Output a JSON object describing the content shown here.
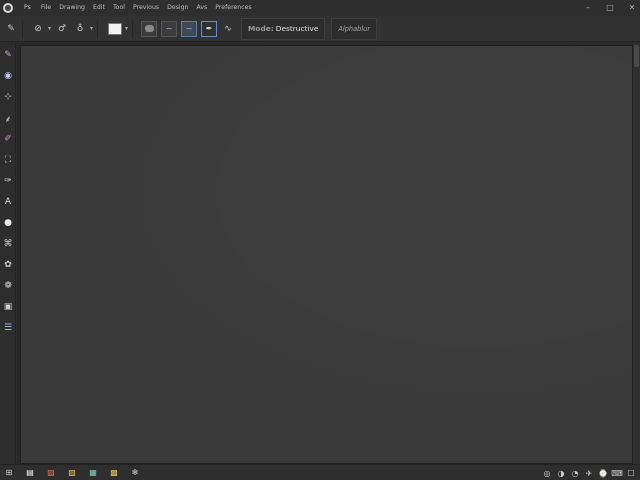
{
  "titlebar": {
    "logo_icon": "app-logo-icon",
    "menu": [
      "Ps",
      "File",
      "Drawing",
      "Edit",
      "Tool",
      "Previous",
      "Design",
      "Avs",
      "Preferences"
    ],
    "controls": {
      "minimize": "–",
      "maximize": "□",
      "close": "✕"
    }
  },
  "optionsbar": {
    "tool_glyph": "✎",
    "size_icon": "⊘",
    "size_arrow": "▾",
    "hardness_glyph": "♂",
    "flow_glyph": "♁",
    "caret": "▾",
    "brush_arrow": "▾",
    "tilde_1": "∼",
    "tilde_2": "∼",
    "paint_glyph": "✒",
    "extra_glyph": "∿",
    "mode_prefix": "Mode:",
    "mode_value": "Destructive",
    "secondary_mode": "Alphablur"
  },
  "toolbox": {
    "tools": [
      {
        "name": "eyedropper-tool",
        "glyph": "✎",
        "color": "#c9a3e6"
      },
      {
        "name": "hand-tool",
        "glyph": "◉",
        "color": "#c8c8ff"
      },
      {
        "name": "transform-tool",
        "glyph": "⊹",
        "color": "#cfcfcf"
      },
      {
        "name": "smudge-tool",
        "glyph": "⸙",
        "color": "#d7d7d7"
      },
      {
        "name": "brush-tool",
        "glyph": "✐",
        "color": "#e58ad8"
      },
      {
        "name": "stamp-tool",
        "glyph": "⛶",
        "color": "#c7c7ff"
      },
      {
        "name": "pen-tool",
        "glyph": "✑",
        "color": "#cfcfcf"
      },
      {
        "name": "type-tool",
        "glyph": "A",
        "color": "#e2e2e2"
      },
      {
        "name": "shape-tool",
        "glyph": "●",
        "color": "#e8e8e8"
      },
      {
        "name": "path-tool",
        "glyph": "⌘",
        "color": "#cfcfcf"
      },
      {
        "name": "dodge-tool",
        "glyph": "✿",
        "color": "#cfcfcf"
      },
      {
        "name": "blur-tool",
        "glyph": "❁",
        "color": "#cfcfcf"
      },
      {
        "name": "mask-tool",
        "glyph": "▣",
        "color": "#cfcfcf"
      },
      {
        "name": "layers-tool",
        "glyph": "☰",
        "color": "#aac4e8"
      }
    ]
  },
  "statusbar": {
    "left_icons": [
      {
        "name": "grid-icon",
        "glyph": "⊞",
        "color": "#cfcfcf"
      },
      {
        "name": "document-icon",
        "glyph": "▤",
        "color": "#ffffff"
      },
      {
        "name": "image-icon",
        "glyph": "▨",
        "color": "#e3735b"
      },
      {
        "name": "picture-icon",
        "glyph": "▧",
        "color": "#e8c46c"
      },
      {
        "name": "chat-icon",
        "glyph": "▦",
        "color": "#7ed0c1"
      },
      {
        "name": "folder-icon",
        "glyph": "▩",
        "color": "#e3c65a"
      },
      {
        "name": "settings-icon",
        "glyph": "✻",
        "color": "#d0d0d0"
      }
    ],
    "right_icons": [
      {
        "name": "wifi-icon",
        "glyph": "◎"
      },
      {
        "name": "sound-icon",
        "glyph": "◑"
      },
      {
        "name": "battery-icon",
        "glyph": "◔"
      },
      {
        "name": "flag-icon",
        "glyph": "✈"
      },
      {
        "name": "clock-icon",
        "glyph": "⌚"
      },
      {
        "name": "keyboard-icon",
        "glyph": "⌨"
      },
      {
        "name": "notification-icon",
        "glyph": "☐"
      }
    ]
  }
}
